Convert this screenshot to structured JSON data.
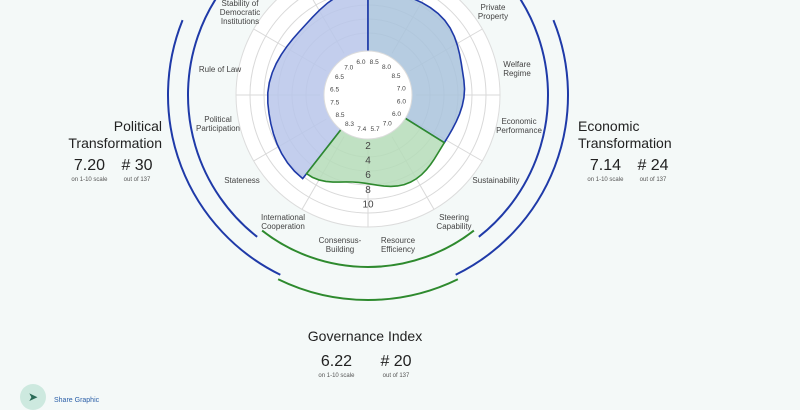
{
  "chart_data": {
    "type": "radar",
    "scale_labels": [
      "2",
      "4",
      "6",
      "8",
      "10"
    ],
    "dimensions": [
      {
        "label": "Stability of Democratic Institutions",
        "value": 8.5,
        "group": "political"
      },
      {
        "label": "Rule of Law",
        "value": 6.5,
        "group": "political"
      },
      {
        "label": "Political Participation",
        "value": 7.5,
        "group": "political"
      },
      {
        "label": "Stateness",
        "value": 8.3,
        "group": "political"
      },
      {
        "label": "Private Property",
        "value": 8.0,
        "group": "economic"
      },
      {
        "label": "Welfare Regime",
        "value": 8.5,
        "group": "economic"
      },
      {
        "label": "Economic Performance",
        "value": 7.0,
        "group": "economic"
      },
      {
        "label": "Sustainability",
        "value": 6.0,
        "group": "economic"
      },
      {
        "label": "Steering Capability",
        "value": 6.0,
        "group": "governance"
      },
      {
        "label": "Resource Efficiency",
        "value": 7.0,
        "group": "governance"
      },
      {
        "label": "Consensus-Building",
        "value": 5.7,
        "group": "governance"
      },
      {
        "label": "International Cooperation",
        "value": 7.4,
        "group": "governance"
      }
    ],
    "inner_values": [
      "6.0",
      "8.5",
      "8.0",
      "8.5",
      "7.0",
      "6.0",
      "6.0",
      "7.0",
      "5.7",
      "7.4",
      "8.3",
      "8.5",
      "7.5",
      "6.5",
      "6.5",
      "7.0"
    ],
    "colors": {
      "political": "#1f3aa8",
      "economic": "#1f3aa8",
      "governance": "#2e8a2e",
      "political_fill": "#b8c5ea",
      "economic_fill": "#a9c3dc",
      "governance_fill": "#b5dcb8"
    }
  },
  "panels": {
    "political": {
      "title_line1": "Political",
      "title_line2": "Transformation",
      "score": "7.20",
      "score_note": "on 1-10 scale",
      "rank": "# 30",
      "rank_note": "out of 137"
    },
    "economic": {
      "title_line1": "Economic",
      "title_line2": "Transformation",
      "score": "7.14",
      "score_note": "on 1-10 scale",
      "rank": "# 24",
      "rank_note": "out of 137"
    },
    "governance": {
      "title_line1": "Governance Index",
      "score": "6.22",
      "score_note": "on 1-10 scale",
      "rank": "# 20",
      "rank_note": "out of 137"
    }
  },
  "share": {
    "icon": "share-icon",
    "label": "Share Graphic"
  }
}
